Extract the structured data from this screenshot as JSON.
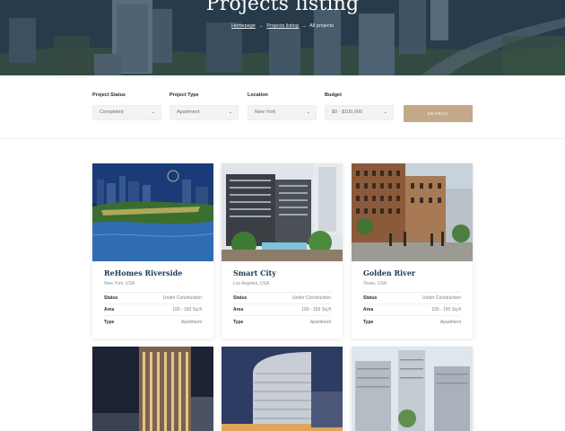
{
  "hero": {
    "title": "Projects listing",
    "breadcrumb": {
      "home": "Homepage",
      "parent": "Projects listing",
      "current": "All projects",
      "separator": "→"
    }
  },
  "filters": {
    "status": {
      "label": "Project Status",
      "value": "Completed"
    },
    "type": {
      "label": "Project Type",
      "value": "Apartment"
    },
    "location": {
      "label": "Location",
      "value": "New York"
    },
    "budget": {
      "label": "Budget",
      "value": "$0 - $100,000"
    },
    "search_label": "SEARCH",
    "chevron": "⌄"
  },
  "row_labels": {
    "status": "Status",
    "area": "Area",
    "type": "Type"
  },
  "projects": [
    {
      "title": "ReHomes Riverside",
      "location": "New York, USA",
      "status": "Under Construction",
      "area": "100 - 150 Sq.ft",
      "type": "Apartment"
    },
    {
      "title": "Smart City",
      "location": "Los Angeles, USA",
      "status": "Under Construction",
      "area": "100 - 150 Sq.ft",
      "type": "Apartment"
    },
    {
      "title": "Golden River",
      "location": "Texas, USA",
      "status": "Under Construction",
      "area": "100 - 150 Sq.ft",
      "type": "Apartment"
    }
  ],
  "colors": {
    "accent": "#c3a98a",
    "title": "#1d3a52",
    "input_bg": "#f2f3f4"
  }
}
